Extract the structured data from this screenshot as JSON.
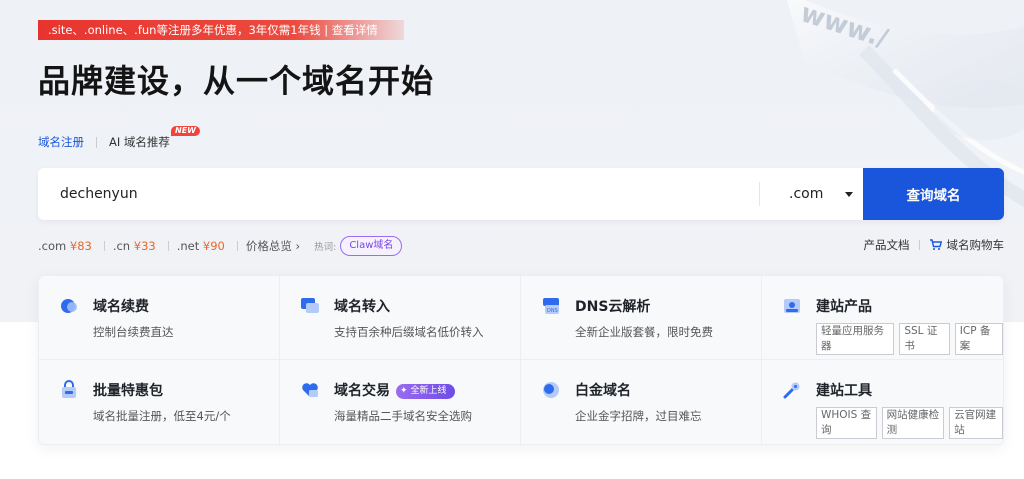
{
  "promo": {
    "text": ".site、.online、.fun等注册多年优惠，3年仅需1年钱 | 查看详情"
  },
  "headline": "品牌建设，从一个域名开始",
  "tabs": {
    "register": "域名注册",
    "ai": "AI 域名推荐",
    "new_badge": "NEW"
  },
  "search": {
    "value": "dechenyun",
    "tld": ".com",
    "button": "查询域名"
  },
  "prices": [
    {
      "tld": ".com",
      "price": "¥83"
    },
    {
      "tld": ".cn",
      "price": "¥33"
    },
    {
      "tld": ".net",
      "price": "¥90"
    }
  ],
  "overview": "价格总览",
  "hot": {
    "label": "热词:",
    "chip": "Claw域名"
  },
  "links": {
    "docs": "产品文档",
    "cart": "域名购物车"
  },
  "services": [
    {
      "title": "域名续费",
      "desc": "控制台续费直达"
    },
    {
      "title": "域名转入",
      "desc": "支持百余种后缀域名低价转入"
    },
    {
      "title": "DNS云解析",
      "desc": "全新企业版套餐，限时免费"
    },
    {
      "title": "建站产品",
      "tags": [
        "轻量应用服务器",
        "SSL 证书",
        "ICP 备案"
      ]
    },
    {
      "title": "批量特惠包",
      "desc": "域名批量注册，低至4元/个"
    },
    {
      "title": "域名交易",
      "badge": "全新上线",
      "desc": "海量精品二手域名安全选购"
    },
    {
      "title": "白金域名",
      "desc": "企业金字招牌，过目难忘"
    },
    {
      "title": "建站工具",
      "tags": [
        "WHOIS 查询",
        "网站健康检测",
        "云官网建站"
      ]
    }
  ],
  "colors": {
    "primary": "#1a56db",
    "promo": "#e8342f",
    "price": "#e8672c",
    "chip": "#7a45e8"
  }
}
